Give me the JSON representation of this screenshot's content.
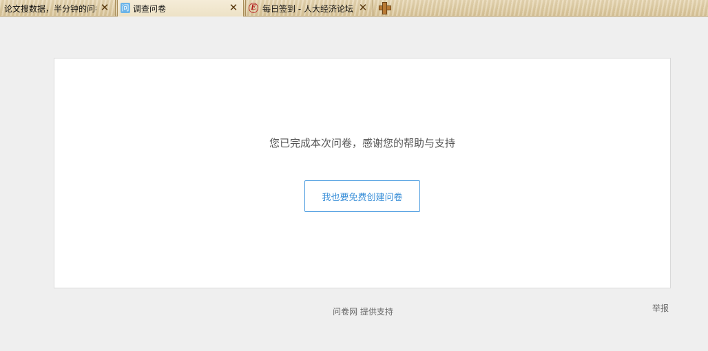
{
  "tabs": [
    {
      "title": "论文搜数据，半分钟的问卷",
      "favicon": "",
      "close_label": "✕",
      "active": false
    },
    {
      "title": "调查问卷",
      "favicon": "问",
      "close_label": "✕",
      "active": true
    },
    {
      "title": "每日签到 - 人大经济论坛",
      "favicon": "E",
      "close_label": "✕",
      "active": false
    }
  ],
  "new_tab_icon": "plus-icon",
  "card": {
    "message": "您已完成本次问卷，感谢您的帮助与支持",
    "create_button_label": "我也要免费创建问卷"
  },
  "footer": {
    "support_text": "问卷网  提供支持",
    "report_label": "举报"
  },
  "colors": {
    "page_bg": "#efefef",
    "accent": "#3a8fd8"
  }
}
